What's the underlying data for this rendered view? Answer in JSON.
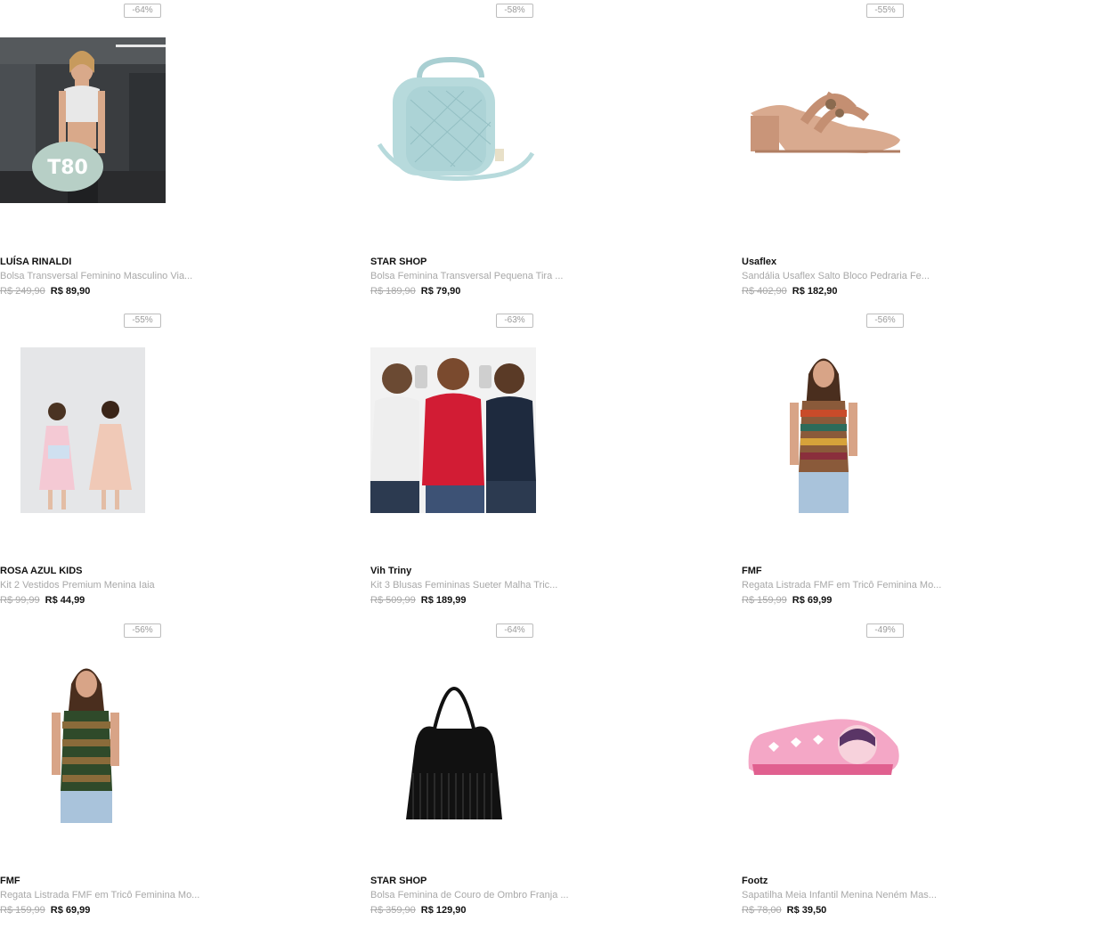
{
  "products": [
    {
      "discount": "-64%",
      "brand": "LUÍSA RINALDI",
      "title": "Bolsa Transversal Feminino Masculino Via...",
      "old_price": "R$ 249,90",
      "price": "R$ 89,90",
      "image": "woman-with-gym-bag-photo"
    },
    {
      "discount": "-58%",
      "brand": "STAR SHOP",
      "title": "Bolsa Feminina Transversal Pequena Tira ...",
      "old_price": "R$ 189,90",
      "price": "R$ 79,90",
      "image": "light-blue-quilted-bag-photo"
    },
    {
      "discount": "-55%",
      "brand": "Usaflex",
      "title": "Sandália Usaflex Salto Bloco Pedraria Fe...",
      "old_price": "R$ 402,90",
      "price": "R$ 182,90",
      "image": "nude-block-heel-sandal-photo"
    },
    {
      "discount": "-55%",
      "brand": "ROSA AZUL KIDS",
      "title": "Kit 2 Vestidos Premium Menina Iaia",
      "old_price": "R$ 99,99",
      "price": "R$ 44,99",
      "image": "two-girls-dresses-photo"
    },
    {
      "discount": "-63%",
      "brand": "Vih Triny",
      "title": "Kit 3 Blusas Femininas Sueter Malha Tric...",
      "old_price": "R$ 509,99",
      "price": "R$ 189,99",
      "image": "three-women-sweaters-photo"
    },
    {
      "discount": "-56%",
      "brand": "FMF",
      "title": "Regata Listrada FMF em Tricô Feminina Mo...",
      "old_price": "R$ 159,99",
      "price": "R$ 69,99",
      "image": "woman-striped-tank-colorful-photo"
    },
    {
      "discount": "-56%",
      "brand": "FMF",
      "title": "Regata Listrada FMF em Tricô Feminina Mo...",
      "old_price": "R$ 159,99",
      "price": "R$ 69,99",
      "image": "woman-striped-tank-green-photo"
    },
    {
      "discount": "-64%",
      "brand": "STAR SHOP",
      "title": "Bolsa Feminina de Couro de Ombro Franja ...",
      "old_price": "R$ 359,90",
      "price": "R$ 129,90",
      "image": "black-fringe-bag-photo"
    },
    {
      "discount": "-49%",
      "brand": "Footz",
      "title": "Sapatilha Meia Infantil Menina Neném Mas...",
      "old_price": "R$ 78,00",
      "price": "R$ 39,50",
      "image": "pink-kids-sock-shoe-photo"
    }
  ],
  "colors": {
    "text": "#111111",
    "muted": "#a8a8a8",
    "badge_border": "#bdbdbd"
  }
}
